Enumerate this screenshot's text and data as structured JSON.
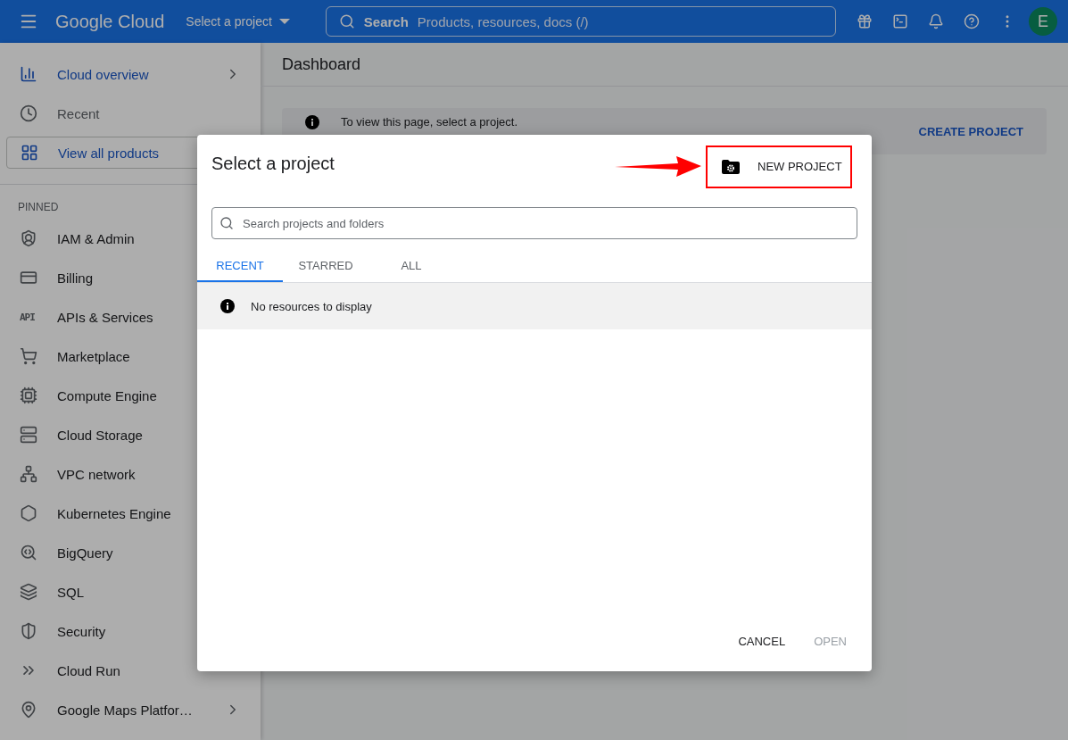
{
  "topbar": {
    "logo": "Google Cloud",
    "project_picker": "Select a project",
    "search": {
      "label": "Search",
      "placeholder": "Products, resources, docs (/)"
    },
    "avatar": "E"
  },
  "sidebar": {
    "top_items": [
      {
        "label": "Cloud overview",
        "kind": "primary",
        "outlined": false,
        "expandable": true
      },
      {
        "label": "Recent",
        "kind": "secondary",
        "outlined": false,
        "expandable": false
      },
      {
        "label": "View all products",
        "kind": "primary",
        "outlined": true,
        "expandable": false
      }
    ],
    "section_label": "PINNED",
    "pinned": [
      {
        "label": "IAM & Admin"
      },
      {
        "label": "Billing"
      },
      {
        "label": "APIs & Services",
        "icon_text": "API"
      },
      {
        "label": "Marketplace"
      },
      {
        "label": "Compute Engine"
      },
      {
        "label": "Cloud Storage"
      },
      {
        "label": "VPC network"
      },
      {
        "label": "Kubernetes Engine"
      },
      {
        "label": "BigQuery"
      },
      {
        "label": "SQL"
      },
      {
        "label": "Security"
      },
      {
        "label": "Cloud Run"
      },
      {
        "label": "Google Maps Platfor…",
        "expandable": true
      }
    ]
  },
  "main": {
    "title": "Dashboard",
    "banner": {
      "text": "To view this page, select a project.",
      "action": "CREATE PROJECT"
    }
  },
  "dialog": {
    "title": "Select a project",
    "new_project": "NEW PROJECT",
    "search_placeholder": "Search projects and folders",
    "tabs": [
      {
        "label": "RECENT",
        "selected": true
      },
      {
        "label": "STARRED",
        "selected": false
      },
      {
        "label": "ALL",
        "selected": false
      }
    ],
    "empty_message": "No resources to display",
    "buttons": [
      {
        "label": "CANCEL",
        "disabled": false
      },
      {
        "label": "OPEN",
        "disabled": true
      }
    ]
  }
}
